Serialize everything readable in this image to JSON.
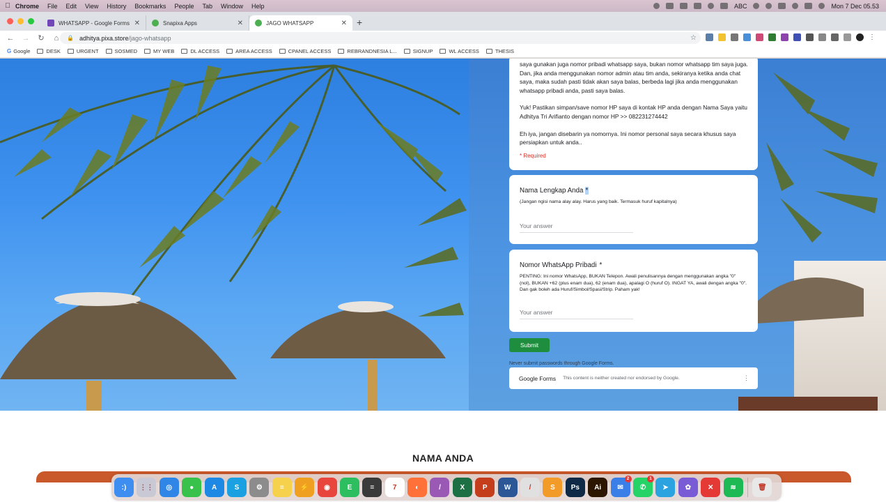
{
  "menubar": {
    "app": "Chrome",
    "items": [
      "File",
      "Edit",
      "View",
      "History",
      "Bookmarks",
      "People",
      "Tab",
      "Window",
      "Help"
    ],
    "input_source": "ABC",
    "clock": "Mon 7 Dec  05.53"
  },
  "tabs": [
    {
      "title": "WHATSAPP - Google Forms",
      "active": false,
      "favicon_color": "#7248b9"
    },
    {
      "title": "Snapixa Apps",
      "active": false,
      "favicon_color": "#4caf50"
    },
    {
      "title": "JAGO WHATSAPP",
      "active": true,
      "favicon_color": "#4caf50"
    }
  ],
  "address": {
    "host": "adhitya.pixa.store",
    "path": "/jago-whatsapp"
  },
  "bookmarks": [
    "Google",
    "DESK",
    "URGENT",
    "SOSMED",
    "MY WEB",
    "DL ACCESS",
    "AREA ACCESS",
    "CPANEL ACCESS",
    "REBRANDNESIA L...",
    "SIGNUP",
    "WL ACCESS",
    "THESIS"
  ],
  "form": {
    "intro_paragraphs": [
      "saya gunakan juga nomor pribadi whatsapp saya, bukan nomor whatsapp tim saya juga. Dan, jika anda menggunakan nomor admin atau tim anda, sekiranya ketika anda chat saya, maka sudah pasti tidak akan saya balas, berbeda lagi jika anda menggunakan whatsapp pribadi anda, pasti saya balas.",
      "Yuk! Pastikan simpan/save nomor HP saya di kontak HP anda dengan Nama Saya yaitu Adhitya Tri Arifianto dengan nomor HP >> 082231274442",
      "Eh iya, jangan disebarin ya nomornya. Ini nomor personal saya secara khusus saya persiapkan untuk anda.."
    ],
    "required_note": "* Required",
    "questions": [
      {
        "title": "Nama Lengkap Anda",
        "star": "*",
        "description": "(Jangan ngisi nama alay alay. Harus yang baik. Termasuk huruf kapitalnya)",
        "placeholder": "Your answer"
      },
      {
        "title": "Nomor WhatsApp Pribadi",
        "star": "*",
        "description": "PENTING: Ini nomor WhatsApp, BUKAN Telepon. Awali penulisannya dengan menggunakan angka \"0\" (nol), BUKAN +62 (plus enam dua), 62 (enam dua), apalagi O (huruf O). INGAT YA, awali dengan angka \"0\". Dan gak boleh ada Huruf/Simbol/Spasi/Strip. Paham yak!",
        "placeholder": "Your answer"
      }
    ],
    "submit_label": "Submit",
    "never_submit": "Never submit passwords through Google Forms.",
    "footer_brand_1": "Google",
    "footer_brand_2": "Forms",
    "footer_note": "This content is neither created nor endorsed by Google."
  },
  "page_heading": "NAMA ANDA",
  "dock": {
    "apps": [
      {
        "name": "Finder",
        "color": "#3d8ef0",
        "glyph": ":)"
      },
      {
        "name": "Launchpad",
        "color": "#c9c9d6",
        "glyph": "⋮⋮"
      },
      {
        "name": "Safari",
        "color": "#2f86e6",
        "glyph": "◎"
      },
      {
        "name": "Messages",
        "color": "#39c24b",
        "glyph": "●"
      },
      {
        "name": "App Store",
        "color": "#1e88e5",
        "glyph": "A"
      },
      {
        "name": "Skype",
        "color": "#1ba1e2",
        "glyph": "S"
      },
      {
        "name": "System Preferences",
        "color": "#8c8c8c",
        "glyph": "⚙"
      },
      {
        "name": "Notes",
        "color": "#f6d24c",
        "glyph": "≡"
      },
      {
        "name": "Reeder",
        "color": "#f0a020",
        "glyph": "⚡"
      },
      {
        "name": "Chrome",
        "color": "#e8453c",
        "glyph": "◉"
      },
      {
        "name": "Evernote",
        "color": "#2dbe60",
        "glyph": "E"
      },
      {
        "name": "Calculator",
        "color": "#3a3a3a",
        "glyph": "="
      },
      {
        "name": "Calendar",
        "color": "#ffffff",
        "glyph": "7"
      },
      {
        "name": "Firefox",
        "color": "#ff7139",
        "glyph": "◐"
      },
      {
        "name": "Pen",
        "color": "#9b59b6",
        "glyph": "/"
      },
      {
        "name": "Excel",
        "color": "#1d7044",
        "glyph": "X"
      },
      {
        "name": "PowerPoint",
        "color": "#c43e1c",
        "glyph": "P"
      },
      {
        "name": "Word",
        "color": "#2b5797",
        "glyph": "W"
      },
      {
        "name": "Scrivener",
        "color": "#e0e0e0",
        "glyph": "/"
      },
      {
        "name": "Sublime",
        "color": "#f29b28",
        "glyph": "S"
      },
      {
        "name": "Photoshop",
        "color": "#0e2a47",
        "glyph": "Ps"
      },
      {
        "name": "Illustrator",
        "color": "#2d1600",
        "glyph": "Ai"
      },
      {
        "name": "Mail",
        "color": "#3a7ee8",
        "glyph": "✉",
        "badge": "2"
      },
      {
        "name": "WhatsApp",
        "color": "#25d366",
        "glyph": "✆",
        "badge": "1"
      },
      {
        "name": "Telegram",
        "color": "#2aa3e0",
        "glyph": "➤"
      },
      {
        "name": "Creative",
        "color": "#7a5bd6",
        "glyph": "✿"
      },
      {
        "name": "Remover",
        "color": "#e53935",
        "glyph": "✕"
      },
      {
        "name": "Spotify",
        "color": "#1db954",
        "glyph": "≋"
      }
    ],
    "trash": {
      "name": "Trash",
      "color": "#e8e8e8",
      "glyph": "🗑"
    }
  }
}
